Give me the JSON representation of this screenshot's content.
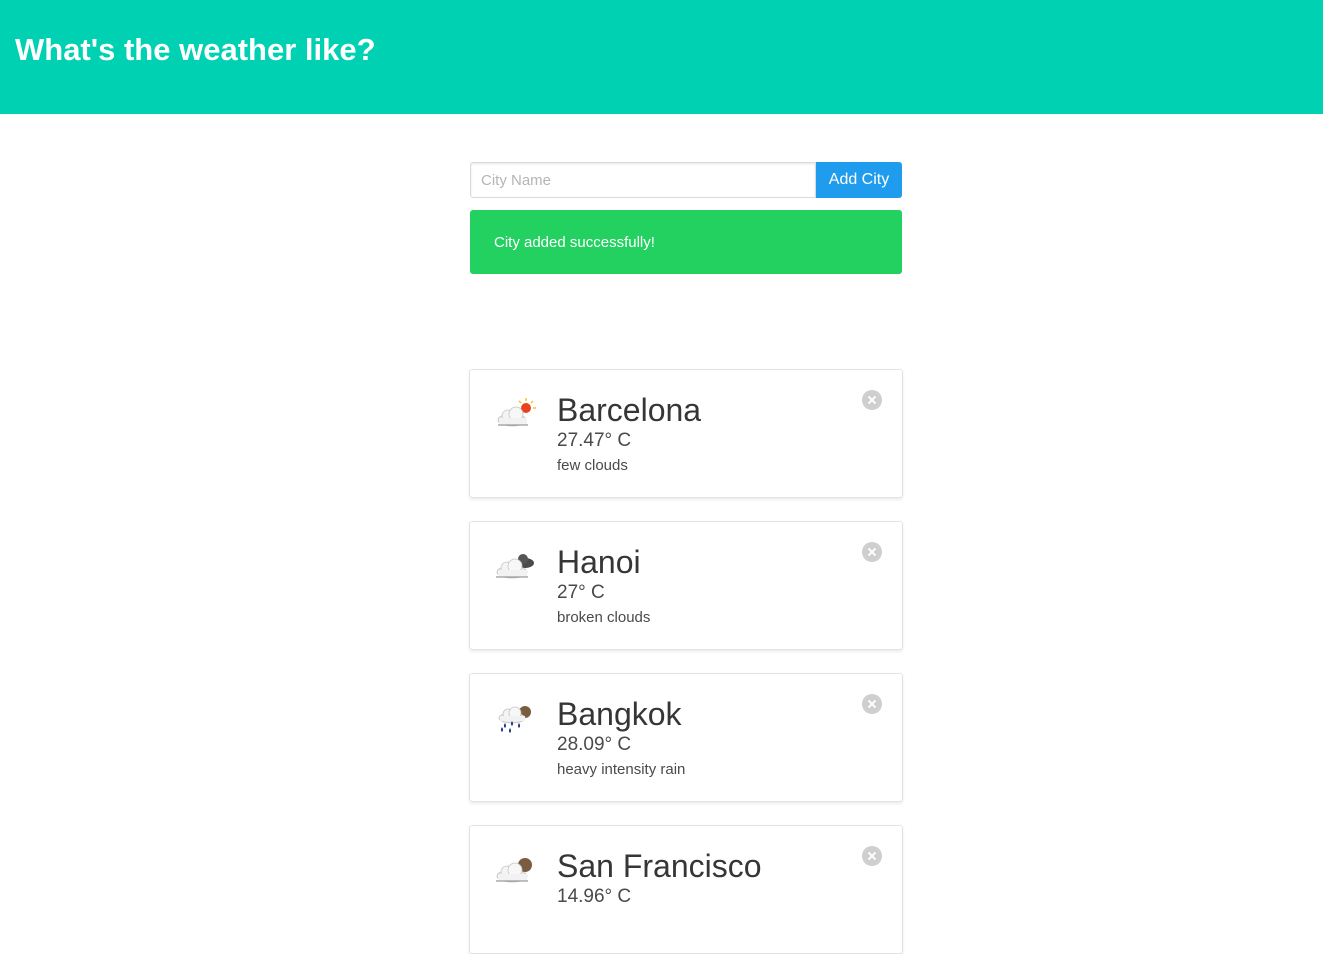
{
  "header": {
    "title": "What's the weather like?",
    "background_color": "#00d1b2"
  },
  "form": {
    "city_input_placeholder": "City Name",
    "city_input_value": "",
    "add_button_label": "Add City",
    "button_color": "#209cee"
  },
  "notification": {
    "message": "City added successfully!",
    "color": "#23d160"
  },
  "cities": [
    {
      "name": "Barcelona",
      "temp": "27.47° C",
      "description": "few clouds",
      "icon": "few-clouds-icon"
    },
    {
      "name": "Hanoi",
      "temp": "27° C",
      "description": "broken clouds",
      "icon": "broken-clouds-icon"
    },
    {
      "name": "Bangkok",
      "temp": "28.09° C",
      "description": "heavy intensity rain",
      "icon": "heavy-rain-icon"
    },
    {
      "name": "San Francisco",
      "temp": "14.96° C",
      "description": "",
      "icon": "night-clouds-icon"
    }
  ]
}
